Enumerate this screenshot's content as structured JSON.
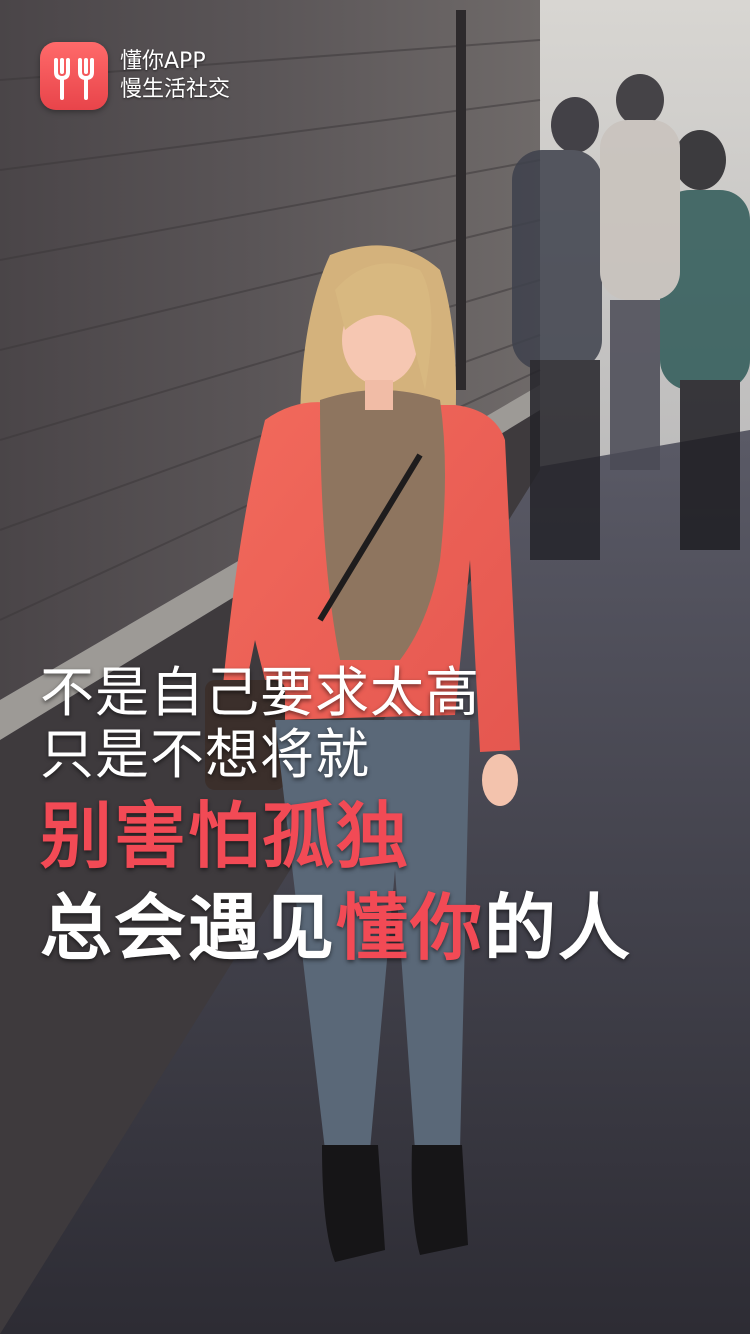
{
  "app": {
    "name": "懂你APP",
    "slogan": "慢生活社交"
  },
  "headline": {
    "line1": "不是自己要求太高",
    "line2": "只是不想将就",
    "line3": "别害怕孤独",
    "line4_prefix": "总会遇见",
    "line4_accent": "懂你",
    "line4_suffix": "的人"
  },
  "colors": {
    "accent": "#f24a55",
    "logo": "#ef5359",
    "text": "#ffffff"
  },
  "icons": {
    "logo": "forks-logo-icon"
  }
}
